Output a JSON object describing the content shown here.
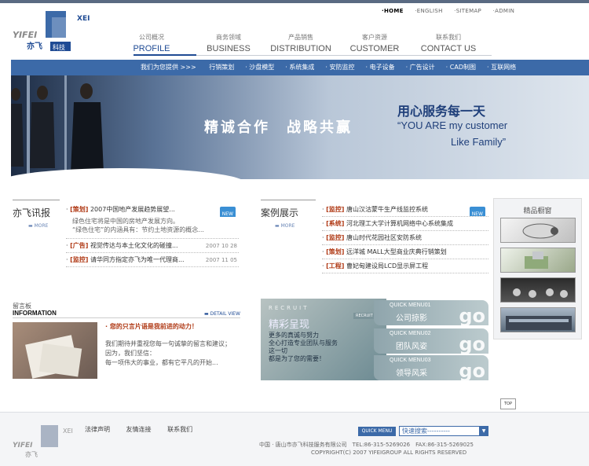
{
  "brand": {
    "name": "亦飞",
    "name2": "科技",
    "logo_en": "YIFEI",
    "logo_vertical": "XEI"
  },
  "toplinks": [
    "·HOME",
    "·ENGLISH",
    "·SITEMAP",
    "·ADMIN"
  ],
  "mainnav": [
    {
      "cn": "公司概况",
      "en": "PROFILE"
    },
    {
      "cn": "商务领域",
      "en": "BUSINESS"
    },
    {
      "cn": "产品销售",
      "en": "DISTRIBUTION"
    },
    {
      "cn": "客户资源",
      "en": "CUSTOMER"
    },
    {
      "cn": "联系我们",
      "en": "CONTACT US"
    }
  ],
  "subnav": {
    "lead": "我们为您提供 >>>",
    "items": [
      "行销策划",
      "沙盘模型",
      "系统集成",
      "安防监控",
      "电子设备",
      "广告设计",
      "CAD制图",
      "互联网络"
    ]
  },
  "banner": {
    "slogan": "精诚合作　战略共赢",
    "right_cn": "用心服务每一天",
    "right_en1": "“YOU ARE my customer",
    "right_en2": "Like Family”"
  },
  "news": {
    "title": "亦飞讯报",
    "more": "MORE",
    "items": [
      {
        "tag": "[策划]",
        "title": "2007中国地产发展趋势展望...",
        "badge": "NEW"
      },
      {
        "tag": "[广告]",
        "title": "视觉传达与本土化文化的碰撞...",
        "date": "2007 10 28"
      },
      {
        "tag": "[监控]",
        "title": "请华同方指定亦飞为唯一代理商...",
        "date": "2007 11 05"
      }
    ],
    "desc1": "绿色住宅将是中国的房地产发展方向。",
    "desc2": "“绿色住宅”的内涵具有：节约土地资源的概念..."
  },
  "cases": {
    "title": "案例展示",
    "more": "MORE",
    "items": [
      {
        "tag": "[监控]",
        "title": "唐山汉沽蒙牛生产线监控系统",
        "badge": "NEW"
      },
      {
        "tag": "[系统]",
        "title": "河北理工大学计算机网络中心系统集成"
      },
      {
        "tag": "[监控]",
        "title": "唐山时代花园社区安防系统"
      },
      {
        "tag": "[策划]",
        "title": "远洋城 MALL大型商业庆典行销策划"
      },
      {
        "tag": "[工程]",
        "title": "曹妃甸建设局LCD显示屏工程"
      }
    ]
  },
  "side": {
    "title": "精品橱窗"
  },
  "message": {
    "title": "留言板",
    "title_en": "INFORMATION",
    "detail": "DETAIL VIEW",
    "headline": "· 您的只言片语是我前进的动力！",
    "line1": "我们期待并重视您每一句诚挚的留言和建议；",
    "line2": "因为，我们坚信：",
    "line3": "每一项伟大的事业，都有它平凡的开始..."
  },
  "recruit": {
    "label": "RECRUIT",
    "btn": "RECRUIT",
    "title": "精彩呈现",
    "t1": "更多的真诚与努力",
    "t2": "全心打造专业团队与服务",
    "t3": "这一切",
    "t4": "都是为了您的需要！"
  },
  "quickmenus": [
    {
      "q": "QUICK MENU01",
      "n": "公司掠影",
      "go": "go"
    },
    {
      "q": "QUICK MENU02",
      "n": "团队风姿",
      "go": "go"
    },
    {
      "q": "QUICK MENU03",
      "n": "领导风采",
      "go": "go"
    }
  ],
  "top_btn": "TOP",
  "footer": {
    "links": [
      "法律声明",
      "友情连接",
      "联系我们"
    ],
    "quick": "QUICK MENU",
    "search": "快速搜索----------",
    "addr": "中国 · 唐山市亦飞科技服务有限公司　TEL:86-315-5269026　FAX:86-315-5269025",
    "copy": "COPYRIGHT(C) 2007 YIFEIGROUP ALL RIGHTS RESERVED"
  },
  "colors": {
    "accent": "#1f4b94",
    "subnav": "#3c6aa8",
    "tag": "#b03a16"
  }
}
